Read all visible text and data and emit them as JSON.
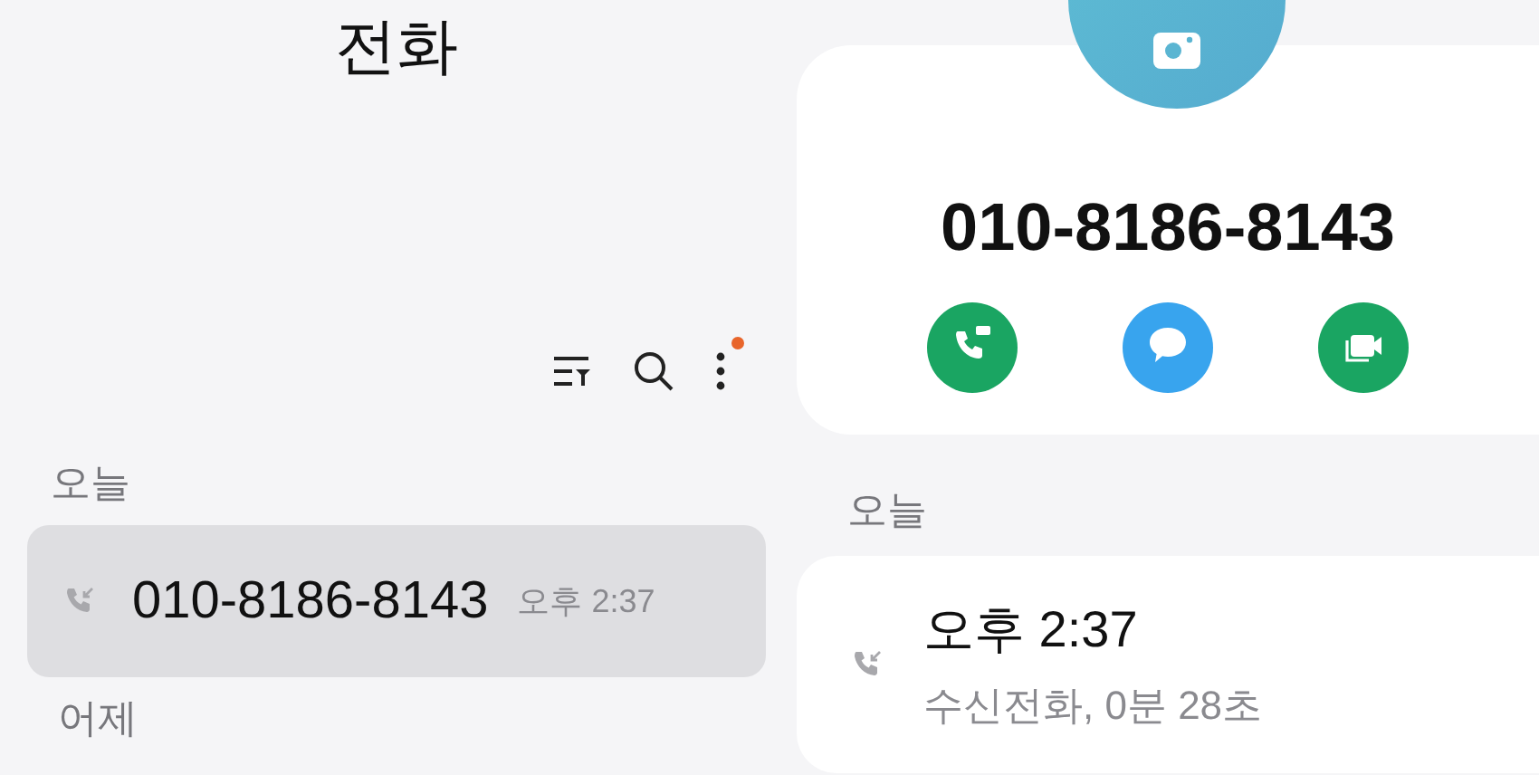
{
  "list_panel": {
    "title": "전화",
    "toolbar": {
      "more_badge": true
    },
    "sections": [
      {
        "heading": "오늘",
        "calls": [
          {
            "number": "010-8186-8143",
            "time": "오후 2:37",
            "kind": "incoming",
            "selected": true
          }
        ]
      },
      {
        "heading": "어제"
      }
    ]
  },
  "detail_panel": {
    "number": "010-8186-8143",
    "actions": [
      {
        "kind": "call",
        "color": "#1aa562"
      },
      {
        "kind": "message",
        "color": "#38a4ee"
      },
      {
        "kind": "video",
        "color": "#1aa562"
      }
    ],
    "history_heading": "오늘",
    "history": [
      {
        "time": "오후 2:37",
        "description": "수신전화, 0분 28초",
        "kind": "incoming"
      }
    ]
  }
}
